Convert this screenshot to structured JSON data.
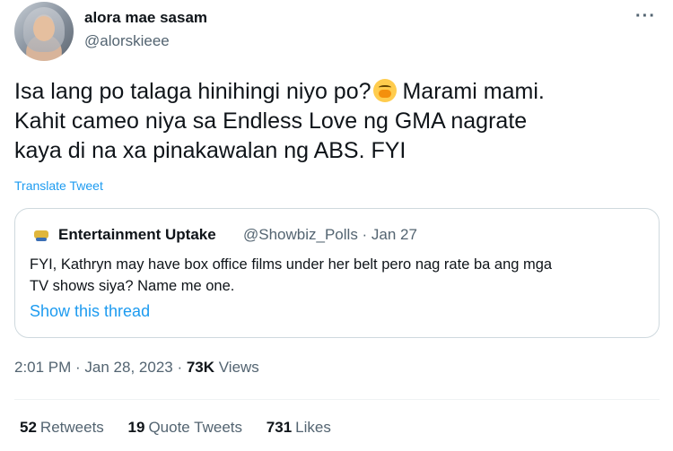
{
  "author": {
    "display_name": "alora mae sasam",
    "handle": "@alorskieee"
  },
  "menu": {
    "more_label": "···"
  },
  "tweet": {
    "lines": [
      "Isa lang po talaga hinihingi niyo po?",
      " Marami mami.",
      "Kahit cameo niya sa Endless Love ng GMA nagrate",
      "kaya di na xa pinakawalan ng ABS. FYI"
    ],
    "emoji": "face-with-hand-over-mouth",
    "translate_label": "Translate Tweet"
  },
  "quoted": {
    "name": "Entertainment Uptake",
    "handle_date": "@Showbiz_Polls · Jan 27",
    "lines": [
      "FYI, Kathryn may have box office films under her belt pero nag rate ba ang mga",
      "TV shows siya? Name me one."
    ],
    "thread_label": "Show this thread"
  },
  "meta": {
    "timestamp": "2:01 PM · Jan 28, 2023 · ",
    "views_count": "73K",
    "views_label": " Views"
  },
  "stats": {
    "retweets": {
      "count": "52",
      "label": "Retweets"
    },
    "quotes": {
      "count": "19",
      "label": "Quote Tweets"
    },
    "likes": {
      "count": "731",
      "label": "Likes"
    }
  },
  "colors": {
    "link": "#1d9bf0",
    "secondary_text": "#536471",
    "primary_text": "#0f1419",
    "border": "#cfd9de"
  }
}
